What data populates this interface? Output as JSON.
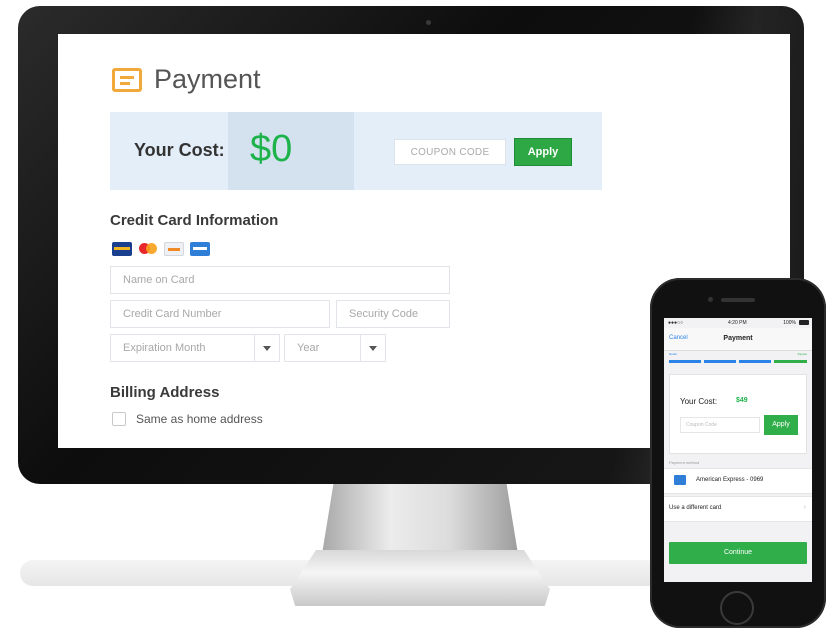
{
  "desktop": {
    "title": "Payment",
    "cost_label": "Your Cost:",
    "cost_value": "$0",
    "coupon_placeholder": "COUPON CODE",
    "apply_label": "Apply",
    "credit_card_heading": "Credit Card Information",
    "card_brands": [
      "visa-icon",
      "mastercard-icon",
      "discover-icon",
      "amex-icon"
    ],
    "name_placeholder": "Name on Card",
    "card_number_placeholder": "Credit Card Number",
    "security_code_placeholder": "Security Code",
    "expiration_month_label": "Expiration Month",
    "year_label": "Year",
    "billing_heading": "Billing Address",
    "same_as_home_label": "Same as home address"
  },
  "mobile": {
    "status_time": "4:20 PM",
    "status_battery": "100%",
    "cancel_label": "Cancel",
    "title": "Payment",
    "step_left": "Detail",
    "step_right": "Payout",
    "cost_label": "Your Cost:",
    "cost_value": "$49",
    "coupon_placeholder": "Coupon Code",
    "apply_label": "Apply",
    "section_label": "Payment method",
    "card_label": "American Express - 0969",
    "different_card_label": "Use a different card",
    "continue_label": "Continue"
  },
  "colors": {
    "accent_green": "#2ea844",
    "cost_green": "#1db34a",
    "icon_orange": "#f0a93a",
    "band_blue": "#e4eef8"
  }
}
